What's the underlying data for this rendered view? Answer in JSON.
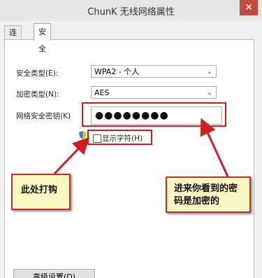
{
  "window": {
    "title": "ChunK 无线网络属性",
    "close_glyph": "✕"
  },
  "tabs": [
    {
      "label": "连接"
    },
    {
      "label": "安全"
    }
  ],
  "fields": {
    "security_type": {
      "label": "安全类型(E):",
      "value": "WPA2 - 个人"
    },
    "encryption_type": {
      "label": "加密类型(N):",
      "value": "AES"
    },
    "network_key": {
      "label": "网络安全密钥(K)",
      "value": "●●●●●●●●"
    }
  },
  "show_chars": {
    "label": "显示字符(H)",
    "checked": false
  },
  "advanced_button": {
    "label": "高级设置(D)"
  },
  "annotations": {
    "left_callout": "此处打钩",
    "right_callout_line1": "进来你看到的密",
    "right_callout_line2": "码是加密的"
  },
  "colors": {
    "annotation_red": "#d01e1e",
    "callout_fill": "#fbf7c2",
    "close_red": "#c74a3e"
  },
  "icons": {
    "close": "close-icon",
    "dropdown": "chevron-down-icon",
    "uac": "shield-icon"
  }
}
